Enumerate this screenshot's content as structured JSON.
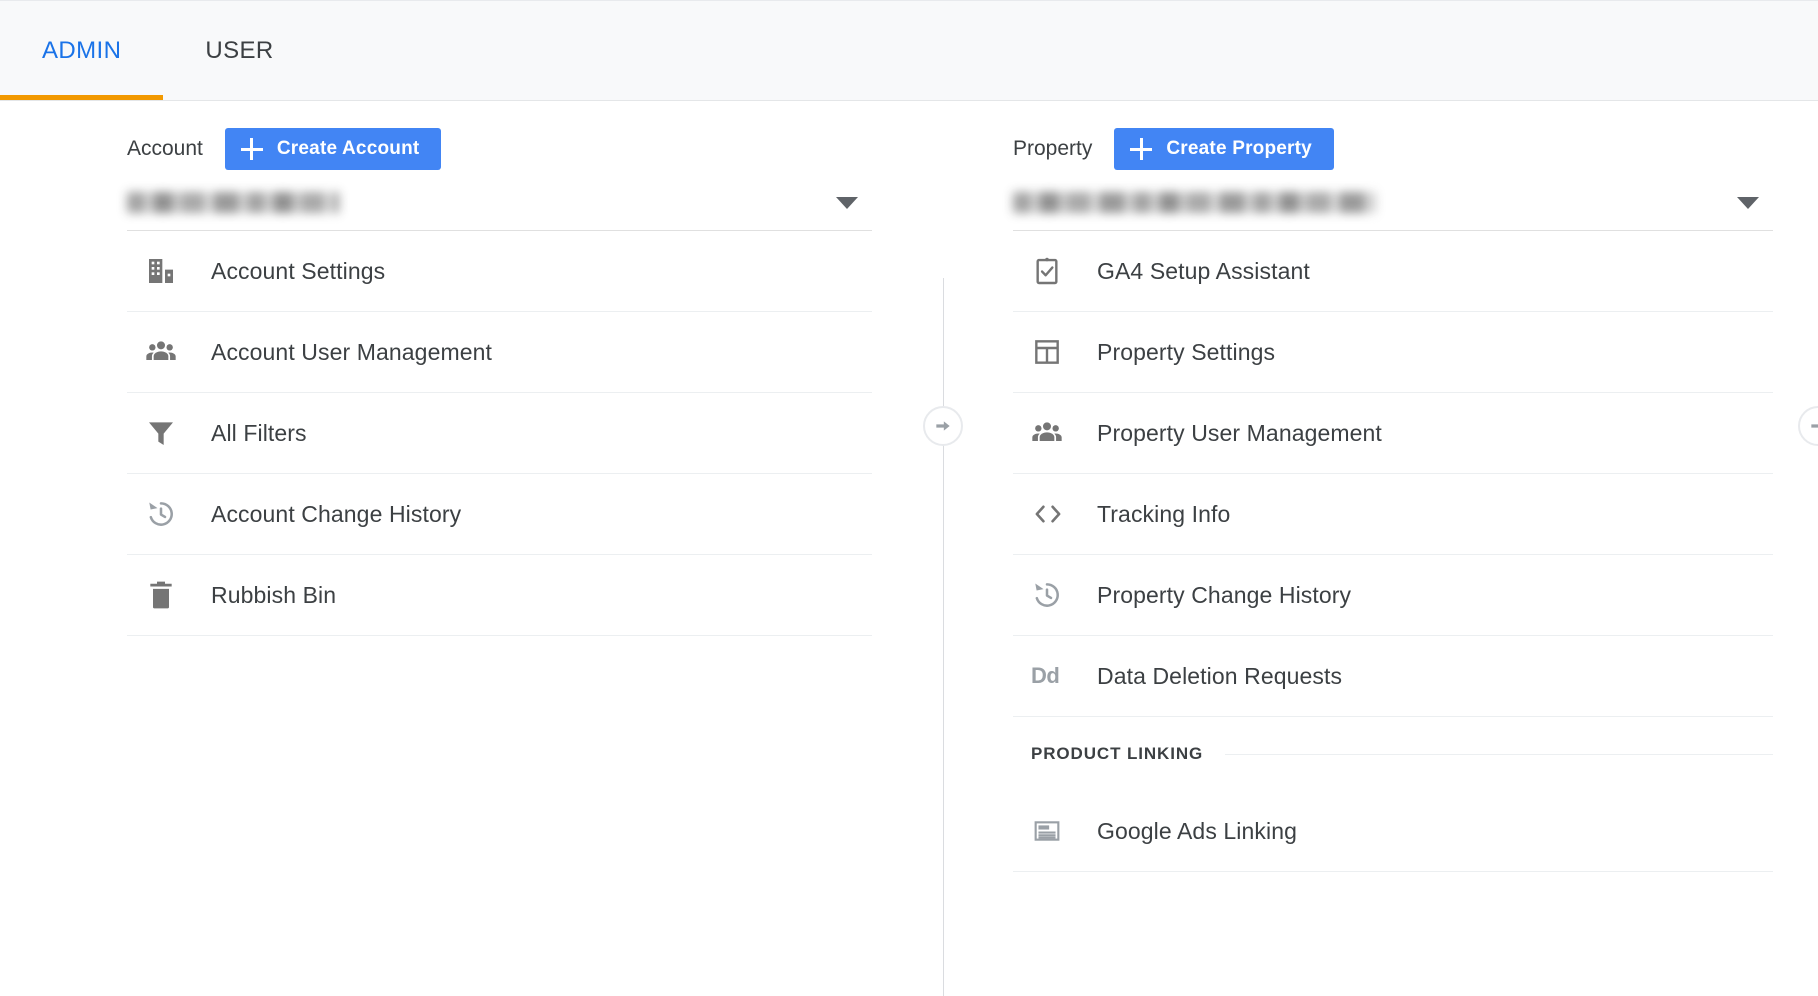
{
  "tabs": [
    {
      "label": "ADMIN",
      "active": true
    },
    {
      "label": "USER",
      "active": false
    }
  ],
  "colors": {
    "accent_blue": "#1a73e8",
    "tab_underline_orange": "#f29900",
    "button_blue": "#4285f4",
    "icon_gray": "#757575",
    "text_primary": "#3c4043",
    "divider": "#eceff1",
    "header_bg": "#f8f9fa"
  },
  "account_column": {
    "label": "Account",
    "create_button": "Create Account",
    "selector": {
      "value": "",
      "redacted": true,
      "caret_icon": "chevron-down-icon"
    },
    "items": [
      {
        "label": "Account Settings",
        "icon": "building-icon"
      },
      {
        "label": "Account User Management",
        "icon": "people-group-icon"
      },
      {
        "label": "All Filters",
        "icon": "funnel-filter-icon"
      },
      {
        "label": "Account Change History",
        "icon": "history-clock-icon"
      },
      {
        "label": "Rubbish Bin",
        "icon": "trash-bin-icon"
      }
    ]
  },
  "property_column": {
    "label": "Property",
    "create_button": "Create Property",
    "selector": {
      "value": "",
      "redacted": true,
      "caret_icon": "chevron-down-icon"
    },
    "items": [
      {
        "label": "GA4 Setup Assistant",
        "icon": "clipboard-check-icon"
      },
      {
        "label": "Property Settings",
        "icon": "web-layout-icon"
      },
      {
        "label": "Property User Management",
        "icon": "people-group-icon"
      },
      {
        "label": "Tracking Info",
        "icon": "code-brackets-icon"
      },
      {
        "label": "Property Change History",
        "icon": "history-clock-icon"
      },
      {
        "label": "Data Deletion Requests",
        "icon": "dd-text-icon",
        "glyph": "Dd"
      }
    ],
    "sections": [
      {
        "title": "PRODUCT LINKING",
        "items": [
          {
            "label": "Google Ads Linking",
            "icon": "ads-banner-icon"
          }
        ]
      }
    ]
  },
  "dividers": {
    "mid_arrow_icon": "arrow-right-circle-icon",
    "right_arrow_icon": "arrow-right-circle-icon"
  }
}
